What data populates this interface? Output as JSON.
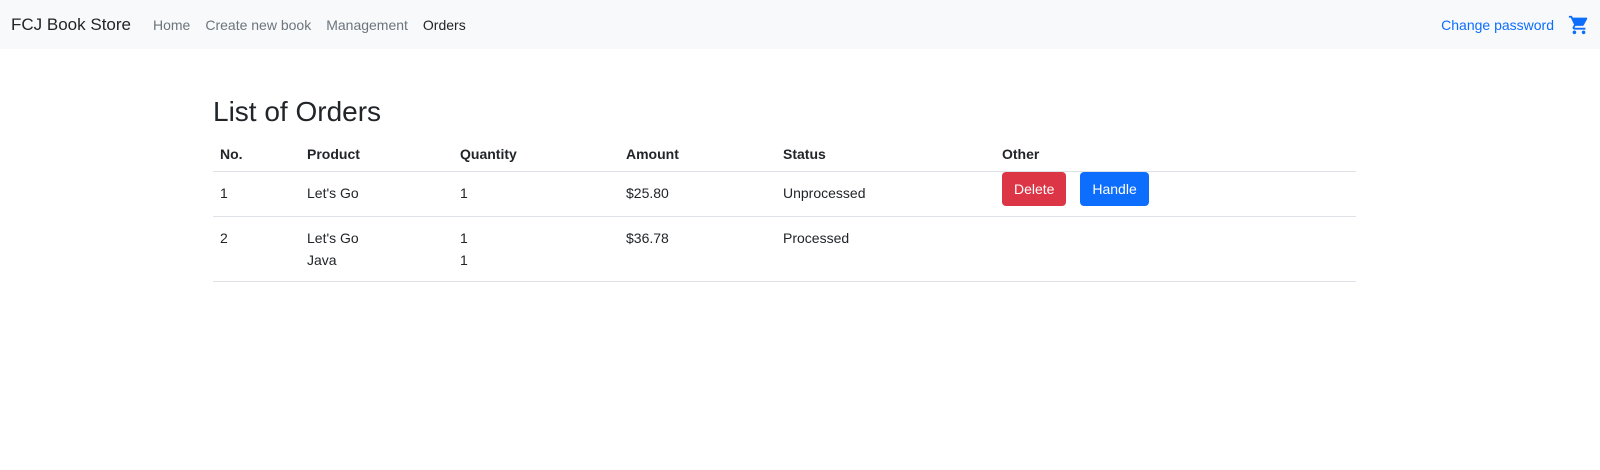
{
  "navbar": {
    "brand": "FCJ Book Store",
    "links": [
      {
        "label": "Home",
        "active": false
      },
      {
        "label": "Create new book",
        "active": false
      },
      {
        "label": "Management",
        "active": false
      },
      {
        "label": "Orders",
        "active": true
      }
    ],
    "change_password": "Change password",
    "cart_icon": "cart-icon"
  },
  "colors": {
    "navbar_bg": "#f8f9fa",
    "link_blue": "#0d6efd",
    "danger": "#dc3545",
    "primary": "#0d6efd"
  },
  "page": {
    "title": "List of Orders"
  },
  "table": {
    "headers": [
      "No.",
      "Product",
      "Quantity",
      "Amount",
      "Status",
      "Other"
    ],
    "rows": [
      {
        "no": "1",
        "products": [
          "Let's Go"
        ],
        "quantities": [
          "1"
        ],
        "amount": "$25.80",
        "status": "Unprocessed",
        "actions": {
          "delete": "Delete",
          "handle": "Handle"
        }
      },
      {
        "no": "2",
        "products": [
          "Let's Go",
          "Java"
        ],
        "quantities": [
          "1",
          "1"
        ],
        "amount": "$36.78",
        "status": "Processed"
      }
    ]
  }
}
